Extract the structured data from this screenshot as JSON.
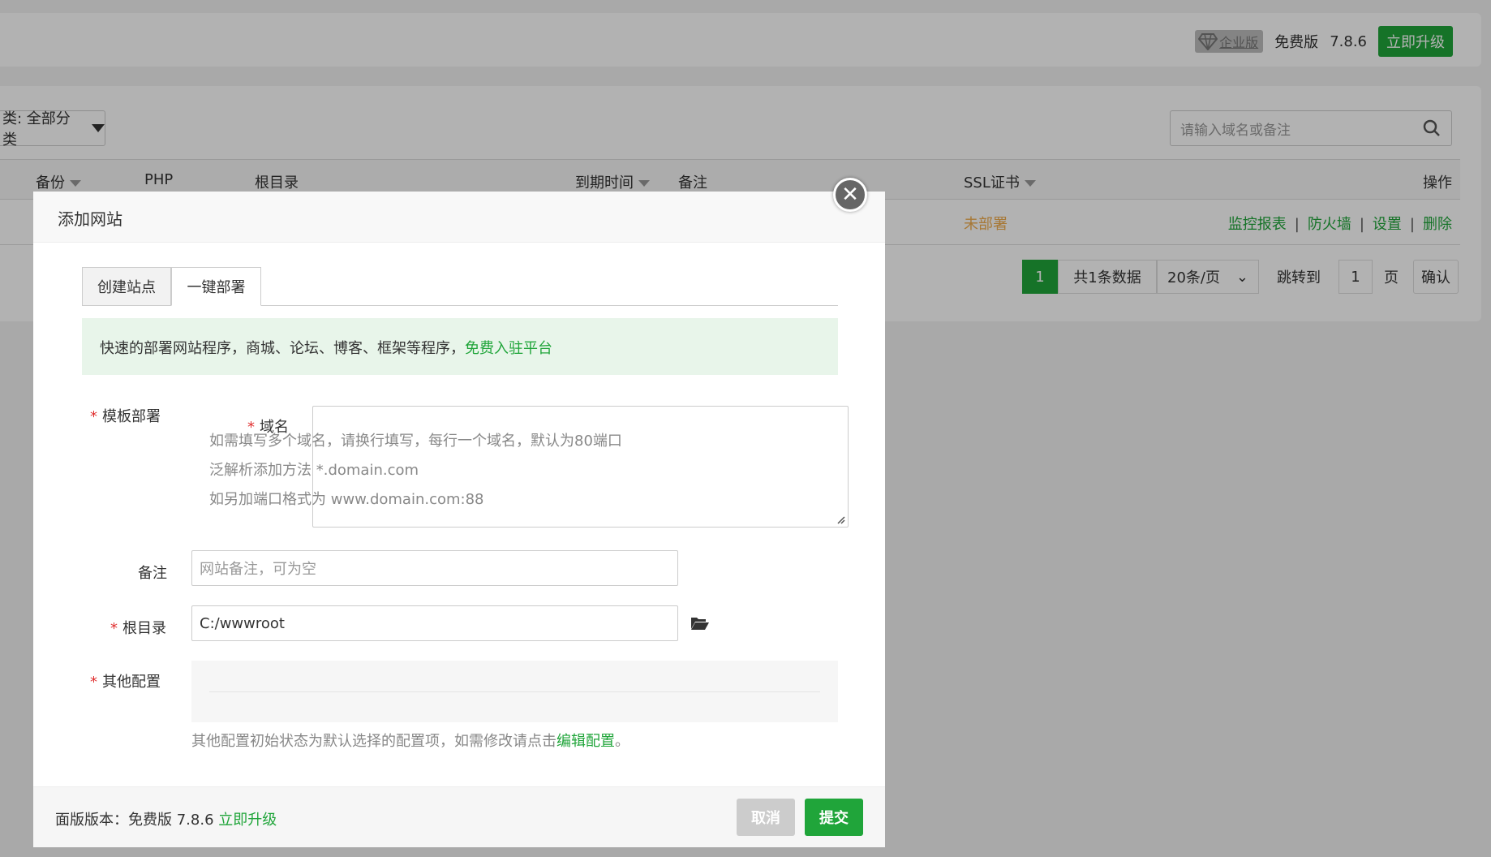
{
  "header": {
    "enterprise_label": "企业版",
    "free_label": "免费版",
    "version": "7.8.6",
    "upgrade_label": "立即升级"
  },
  "toolbar": {
    "category_label": "类: 全部分类",
    "search_placeholder": "请输入域名或备注"
  },
  "table": {
    "columns": {
      "backup": "备份",
      "php": "PHP",
      "root": "根目录",
      "expire": "到期时间",
      "remark": "备注",
      "ssl": "SSL证书",
      "ops": "操作"
    },
    "row": {
      "ssl_status": "未部署",
      "ops": [
        "监控报表",
        "防火墙",
        "设置",
        "删除"
      ]
    }
  },
  "pager": {
    "current": "1",
    "total": "共1条数据",
    "per_page": "20条/页",
    "jump_label": "跳转到",
    "jump_value": "1",
    "page_unit": "页",
    "confirm": "确认"
  },
  "modal": {
    "title": "添加网站",
    "tabs": [
      "创建站点",
      "一键部署"
    ],
    "tip_text": "快速的部署网站程序，商城、论坛、博客、框架等程序，",
    "tip_link": "免费入驻平台",
    "template_label": "模板部署",
    "domain_label": "域名",
    "domain_placeholder": [
      "如需填写多个域名，请换行填写，每行一个域名，默认为80端口",
      "泛解析添加方法 *.domain.com",
      "如另加端口格式为 www.domain.com:88"
    ],
    "remark_label": "备注",
    "remark_placeholder": "网站备注，可为空",
    "root_label": "根目录",
    "root_value": "C:/wwwroot",
    "other_label": "其他配置",
    "other_hint": "其他配置初始状态为默认选择的配置项，如需修改请点击",
    "other_hint_link": "编辑配置",
    "other_hint_end": "。",
    "footer_version": "面版版本：免费版 7.8.6 ",
    "footer_upgrade": "立即升级",
    "cancel": "取消",
    "submit": "提交"
  }
}
